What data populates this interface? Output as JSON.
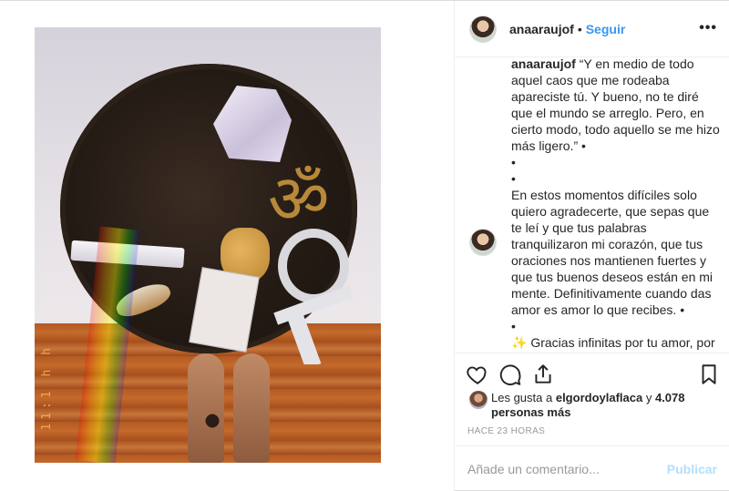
{
  "post": {
    "username": "anaaraujof",
    "follow_label": "Seguir",
    "dot": "•",
    "more_label": "•••",
    "image_stamp": "11:1 h h",
    "caption": {
      "username": "anaaraujof",
      "lines": [
        "“Y en medio de todo aquel caos que me rodeaba apareciste tú. Y bueno, no te diré que el mundo se arreglo. Pero, en cierto modo, todo aquello se me hizo más ligero.” •",
        "•",
        "•",
        "En estos momentos difíciles solo quiero agradecerte, que sepas que te leí y que tus palabras tranquilizaron mi corazón, que tus oraciones nos mantienen fuertes y que tus buenos deseos están en mi mente. Definitivamente cuando das amor es amor lo que recibes. •",
        "•",
        "Gracias infinitas por tu amor, por tu respeto, por tu apoyo, por tus oraciones, por tus consejos, por tu sentido común, por vivirlo con"
      ],
      "sparkle": "✨"
    },
    "likes": {
      "prefix": "Les gusta a",
      "user": "elgordoylaflaca",
      "joiner": "y",
      "count": "4.078 personas más"
    },
    "time": "HACE 23 HORAS",
    "comment_placeholder": "Añade un comentario...",
    "publish_label": "Publicar"
  },
  "colors": {
    "accent": "#3897f0",
    "publish_disabled": "#b2dffc",
    "muted": "#999999"
  },
  "icons": [
    "heart-icon",
    "comment-icon",
    "share-icon",
    "bookmark-icon",
    "more-icon"
  ]
}
